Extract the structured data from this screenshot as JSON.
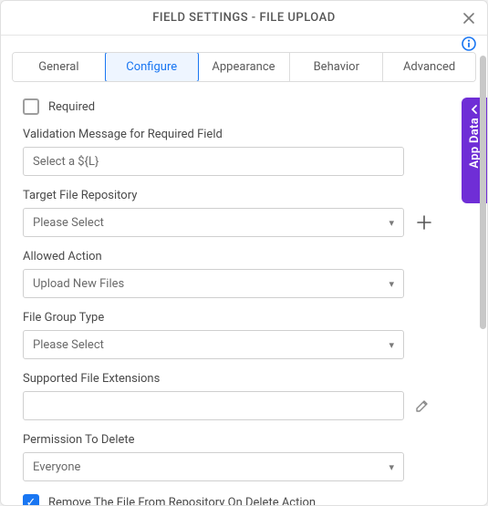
{
  "title": "FIELD SETTINGS - FILE UPLOAD",
  "info_icon": "info",
  "tabs": {
    "items": [
      "General",
      "Configure",
      "Appearance",
      "Behavior",
      "Advanced"
    ],
    "active_index": 1
  },
  "sidebar": {
    "app_data_label": "App Data"
  },
  "form": {
    "required": {
      "label": "Required",
      "checked": false
    },
    "validation_msg": {
      "label": "Validation Message for Required Field",
      "value": "Select a ${L}"
    },
    "target_repo": {
      "label": "Target File Repository",
      "value": "Please Select"
    },
    "allowed_action": {
      "label": "Allowed Action",
      "value": "Upload New Files"
    },
    "file_group_type": {
      "label": "File Group Type",
      "value": "Please Select"
    },
    "supported_ext": {
      "label": "Supported File Extensions",
      "value": ""
    },
    "perm_delete": {
      "label": "Permission To Delete",
      "value": "Everyone"
    },
    "remove_on_delete": {
      "label": "Remove The File From Repository On Delete Action",
      "checked": true
    }
  }
}
